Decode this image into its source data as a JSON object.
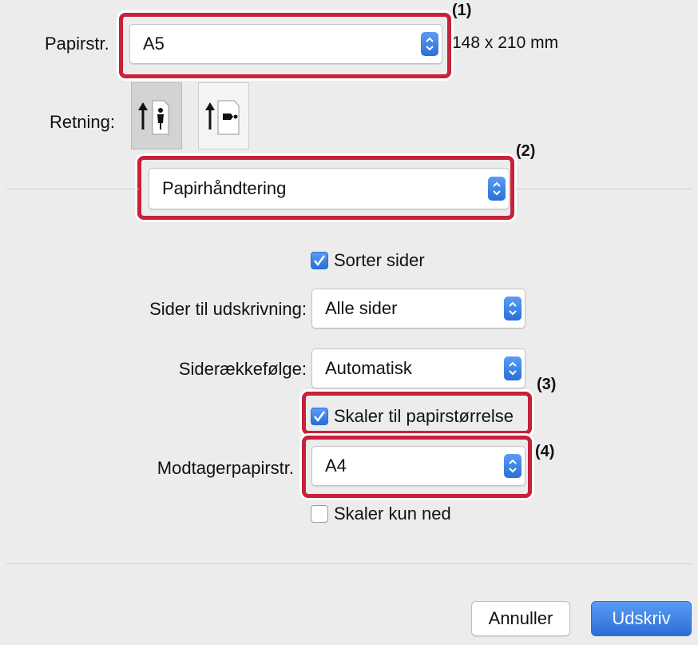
{
  "paper_size": {
    "label": "Papirstr.",
    "value": "A5",
    "dimensions": "148 x 210 mm"
  },
  "orientation": {
    "label": "Retning:"
  },
  "panel_menu": {
    "value": "Papirhåndtering"
  },
  "collate": {
    "label": "Sorter sider",
    "checked": true
  },
  "pages_to_print": {
    "label": "Sider til udskrivning:",
    "value": "Alle sider"
  },
  "page_order": {
    "label": "Siderækkefølge:",
    "value": "Automatisk"
  },
  "scale_to_fit": {
    "label": "Skaler til papirstørrelse",
    "checked": true
  },
  "destination_paper": {
    "label": "Modtagerpapirstr.",
    "value": "A4"
  },
  "scale_down_only": {
    "label": "Skaler kun ned",
    "checked": false
  },
  "buttons": {
    "cancel": "Annuller",
    "print": "Udskriv"
  },
  "callouts": {
    "c1": "(1)",
    "c2": "(2)",
    "c3": "(3)",
    "c4": "(4)"
  },
  "colors": {
    "accent": "#2a6fd6",
    "highlight": "#c8213a"
  }
}
